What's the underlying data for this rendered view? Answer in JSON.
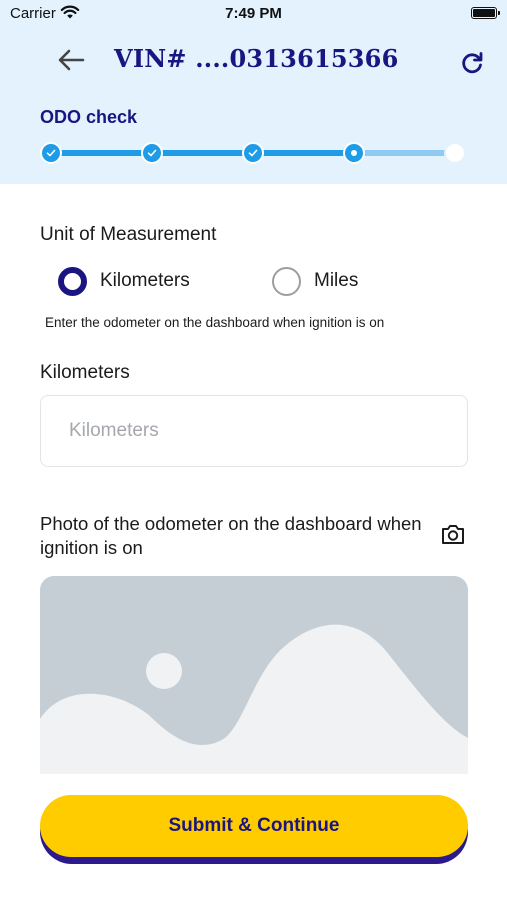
{
  "status_bar": {
    "carrier": "Carrier",
    "time": "7:49 PM"
  },
  "nav": {
    "title": "VIN# ....0313615366"
  },
  "progress": {
    "step_title": "ODO check",
    "total_steps": 5,
    "completed_steps": 3,
    "current_step": 4
  },
  "unit": {
    "label": "Unit of Measurement",
    "options": [
      "Kilometers",
      "Miles"
    ],
    "selected": "Kilometers"
  },
  "hint": "Enter the odometer on the dashboard when ignition is on",
  "odometer": {
    "label": "Kilometers",
    "placeholder": "Kilometers",
    "value": ""
  },
  "photo": {
    "label": "Photo of the odometer on the dashboard when ignition is on"
  },
  "submit": {
    "label": "Submit & Continue"
  },
  "colors": {
    "header_bg": "#e3f2fd",
    "brand_navy": "#1a1580",
    "progress_blue": "#1e9ce8",
    "button_yellow": "#ffcc00"
  }
}
